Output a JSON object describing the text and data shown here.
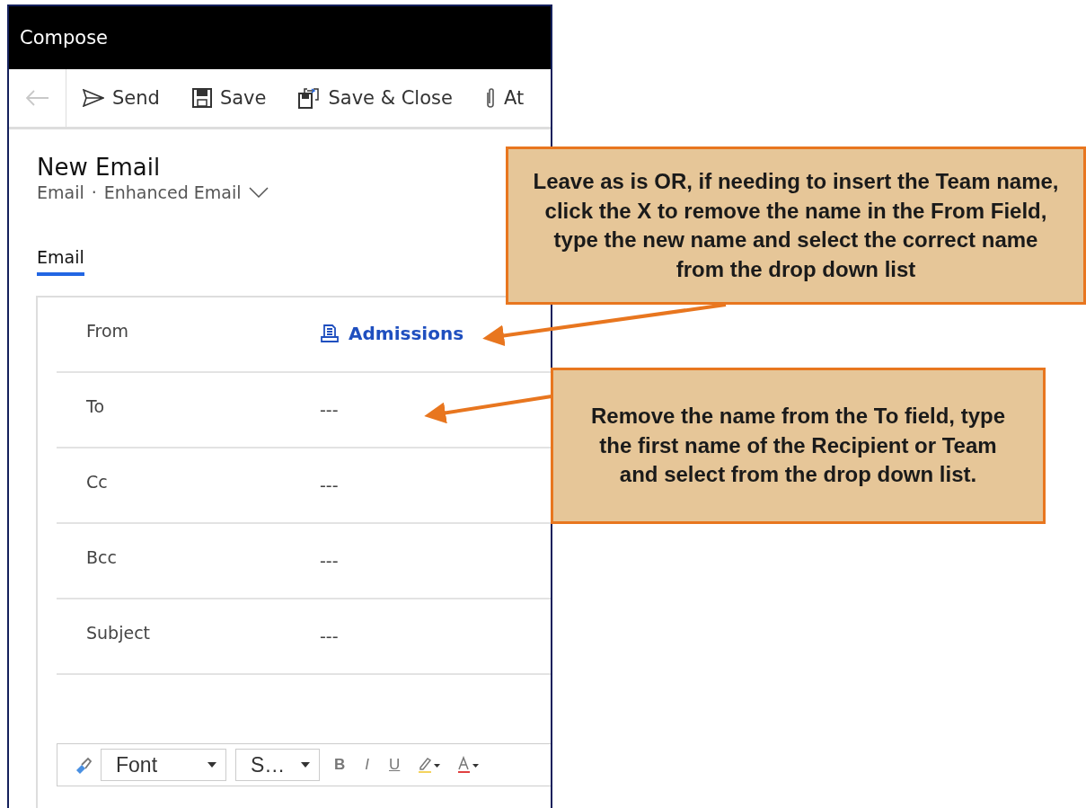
{
  "window": {
    "title": "Compose"
  },
  "toolbar": {
    "back_disabled": true,
    "items": [
      {
        "kind": "send",
        "label": "Send"
      },
      {
        "kind": "save",
        "label": "Save"
      },
      {
        "kind": "save-close",
        "label": "Save & Close"
      },
      {
        "kind": "attach",
        "label": "At"
      }
    ]
  },
  "header": {
    "title": "New Email",
    "entity": "Email",
    "separator": "·",
    "form": "Enhanced Email"
  },
  "tabs": [
    {
      "label": "Email",
      "selected": true
    }
  ],
  "fields": [
    {
      "label": "From",
      "kind": "lookup",
      "value": "Admissions"
    },
    {
      "label": "To",
      "kind": "empty",
      "value": "---"
    },
    {
      "label": "Cc",
      "kind": "empty",
      "value": "---"
    },
    {
      "label": "Bcc",
      "kind": "empty",
      "value": "---"
    },
    {
      "label": "Subject",
      "kind": "empty",
      "value": "---"
    }
  ],
  "editor_toolbar": {
    "font": "Font",
    "size": "S…",
    "bold": "B",
    "italic": "I",
    "underline": "U"
  },
  "callouts": [
    {
      "text": "Leave as is OR, if needing to insert the Team name, click the X to remove the name in the From Field, type the new name and select the correct name from the drop down list"
    },
    {
      "text": "Remove the name from the To field, type the first name of the Recipient or Team and select from the drop down list."
    }
  ]
}
